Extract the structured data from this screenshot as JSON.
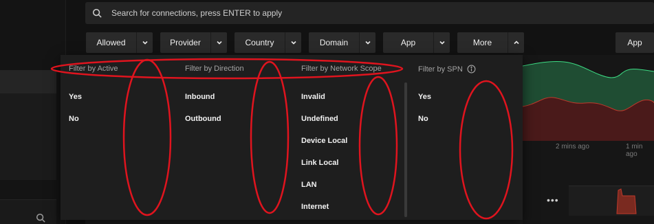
{
  "search": {
    "placeholder": "Search for connections, press ENTER to apply"
  },
  "filters": [
    {
      "label": "Allowed"
    },
    {
      "label": "Provider"
    },
    {
      "label": "Country"
    },
    {
      "label": "Domain"
    },
    {
      "label": "App"
    },
    {
      "label": "More"
    }
  ],
  "right_button": {
    "label": "App"
  },
  "dropdown": {
    "columns": [
      {
        "title": "Filter by Active",
        "options": [
          "Yes",
          "No"
        ]
      },
      {
        "title": "Filter by Direction",
        "options": [
          "Inbound",
          "Outbound"
        ]
      },
      {
        "title": "Filter by Network Scope",
        "options": [
          "Invalid",
          "Undefined",
          "Device Local",
          "Link Local",
          "LAN",
          "Internet"
        ]
      },
      {
        "title": "Filter by SPN",
        "options": [
          "Yes",
          "No"
        ]
      }
    ]
  },
  "chart": {
    "ticks": [
      "2 mins ago",
      "1 min ago"
    ],
    "colors": {
      "allowed": "#2e7d4f",
      "allowed_line": "#3ddc84",
      "blocked": "#5a1e1e",
      "blocked_line": "#c0392b"
    }
  },
  "annotation": {
    "color": "#e0141e"
  },
  "icons": {
    "search": "search-icon",
    "chevron_down": "chevron-down-icon",
    "chevron_up": "chevron-up-icon",
    "info": "info-icon",
    "more": "more-horizontal-icon"
  },
  "more_label": "•••"
}
